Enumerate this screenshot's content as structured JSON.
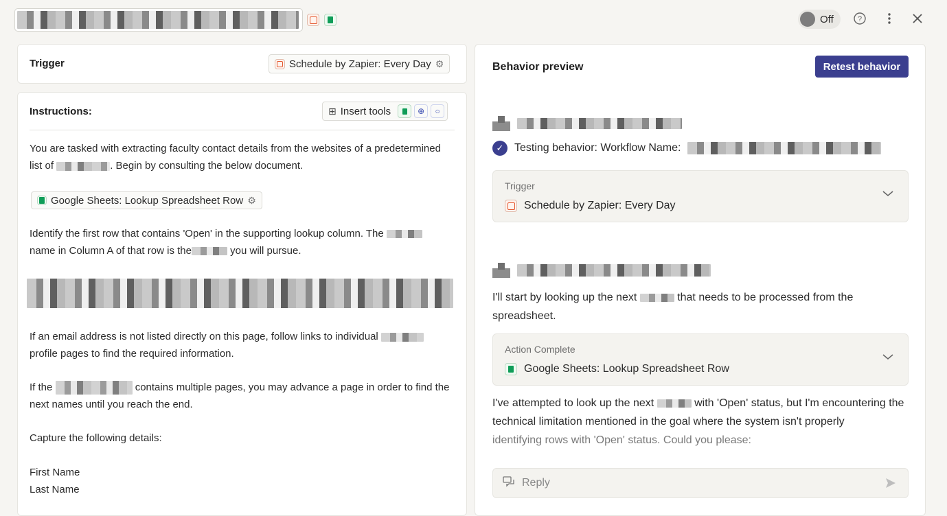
{
  "header": {
    "toggle_label": "Off",
    "help_icon": "question-circle-icon",
    "more_icon": "vertical-dots-icon",
    "close_icon": "close-icon"
  },
  "trigger_card": {
    "title": "Trigger",
    "chip_label": "Schedule by Zapier: Every Day"
  },
  "instructions": {
    "title": "Instructions:",
    "insert_tools_label": "Insert tools",
    "para1_a": "You are tasked with extracting faculty contact details from the websites of a predetermined list of",
    "para1_b": ". Begin by consulting the below document.",
    "lookup_chip": "Google Sheets: Lookup Spreadsheet Row",
    "para2_a": "Identify the first row that contains 'Open' in the supporting lookup column. The",
    "para2_b": "name in Column A of that row is the",
    "para2_c": "you will pursue.",
    "para3_a": "If an email address is not listed directly on this page, follow links to individual",
    "para3_b": "profile pages to find the required information.",
    "para4_a": "If the",
    "para4_b": "contains multiple pages, you may advance a page in order to find the next names until you reach the end.",
    "para5": "Capture the following details:",
    "field1": "First Name",
    "field2": "Last Name"
  },
  "preview": {
    "title": "Behavior preview",
    "retest_label": "Retest behavior",
    "testing_label": "Testing behavior: Workflow Name:",
    "trigger_acc": {
      "label": "Trigger",
      "value": "Schedule by Zapier: Every Day"
    },
    "msg1_a": "I'll start by looking up the next",
    "msg1_b": "that needs to be processed from the spreadsheet.",
    "action_acc": {
      "label": "Action Complete",
      "value": "Google Sheets: Lookup Spreadsheet Row"
    },
    "msg2_a": "I've attempted to look up the next",
    "msg2_b": "with 'Open' status, but I'm encountering the technical limitation mentioned in the goal where the system isn't properly",
    "msg2_c": "identifying rows with 'Open' status. Could you please:",
    "reply_placeholder": "Reply"
  }
}
